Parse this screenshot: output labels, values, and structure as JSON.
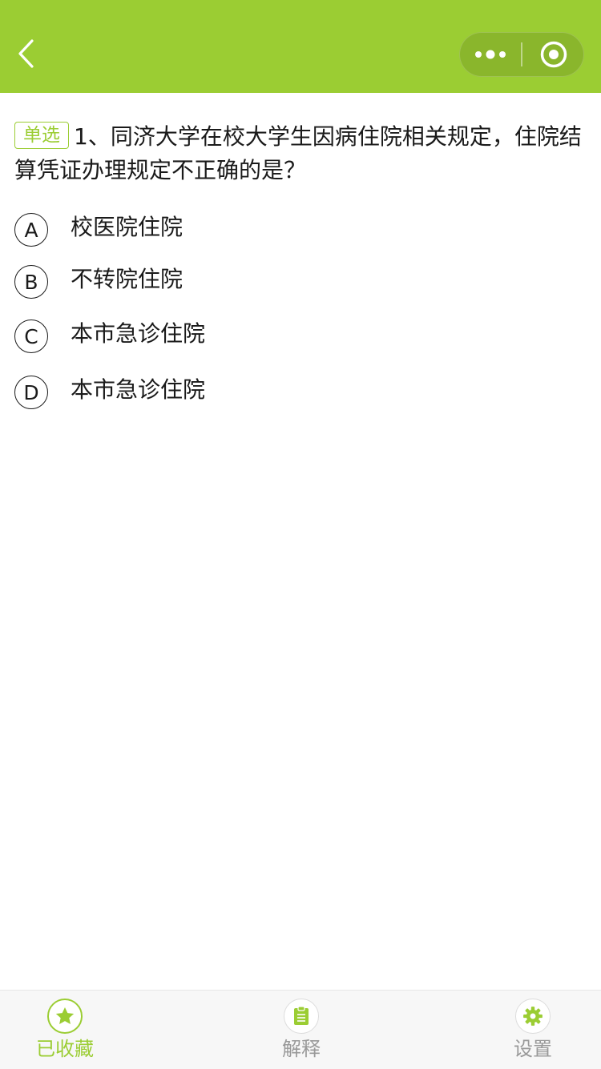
{
  "colors": {
    "brand": "#9bcd33",
    "capsule": "#8ab62c",
    "text": "#1a1a1a",
    "muted": "#999999"
  },
  "header": {
    "back_icon": "chevron-left-icon",
    "menu_icon": "more-dots-icon",
    "home_icon": "target-circle-icon"
  },
  "question": {
    "type_tag": "单选",
    "text": "1、同济大学在校大学生因病住院相关规定，住院结算凭证办理规定不正确的是？"
  },
  "options": [
    {
      "letter": "A",
      "text": "校医院住院"
    },
    {
      "letter": "B",
      "text": "不转院住院"
    },
    {
      "letter": "C",
      "text": "本市急诊住院"
    },
    {
      "letter": "D",
      "text": "本市急诊住院"
    }
  ],
  "tabbar": {
    "favorite": {
      "label": "已收藏",
      "icon": "star-icon"
    },
    "explain": {
      "label": "解释",
      "icon": "clipboard-icon"
    },
    "settings": {
      "label": "设置",
      "icon": "gear-icon"
    }
  }
}
